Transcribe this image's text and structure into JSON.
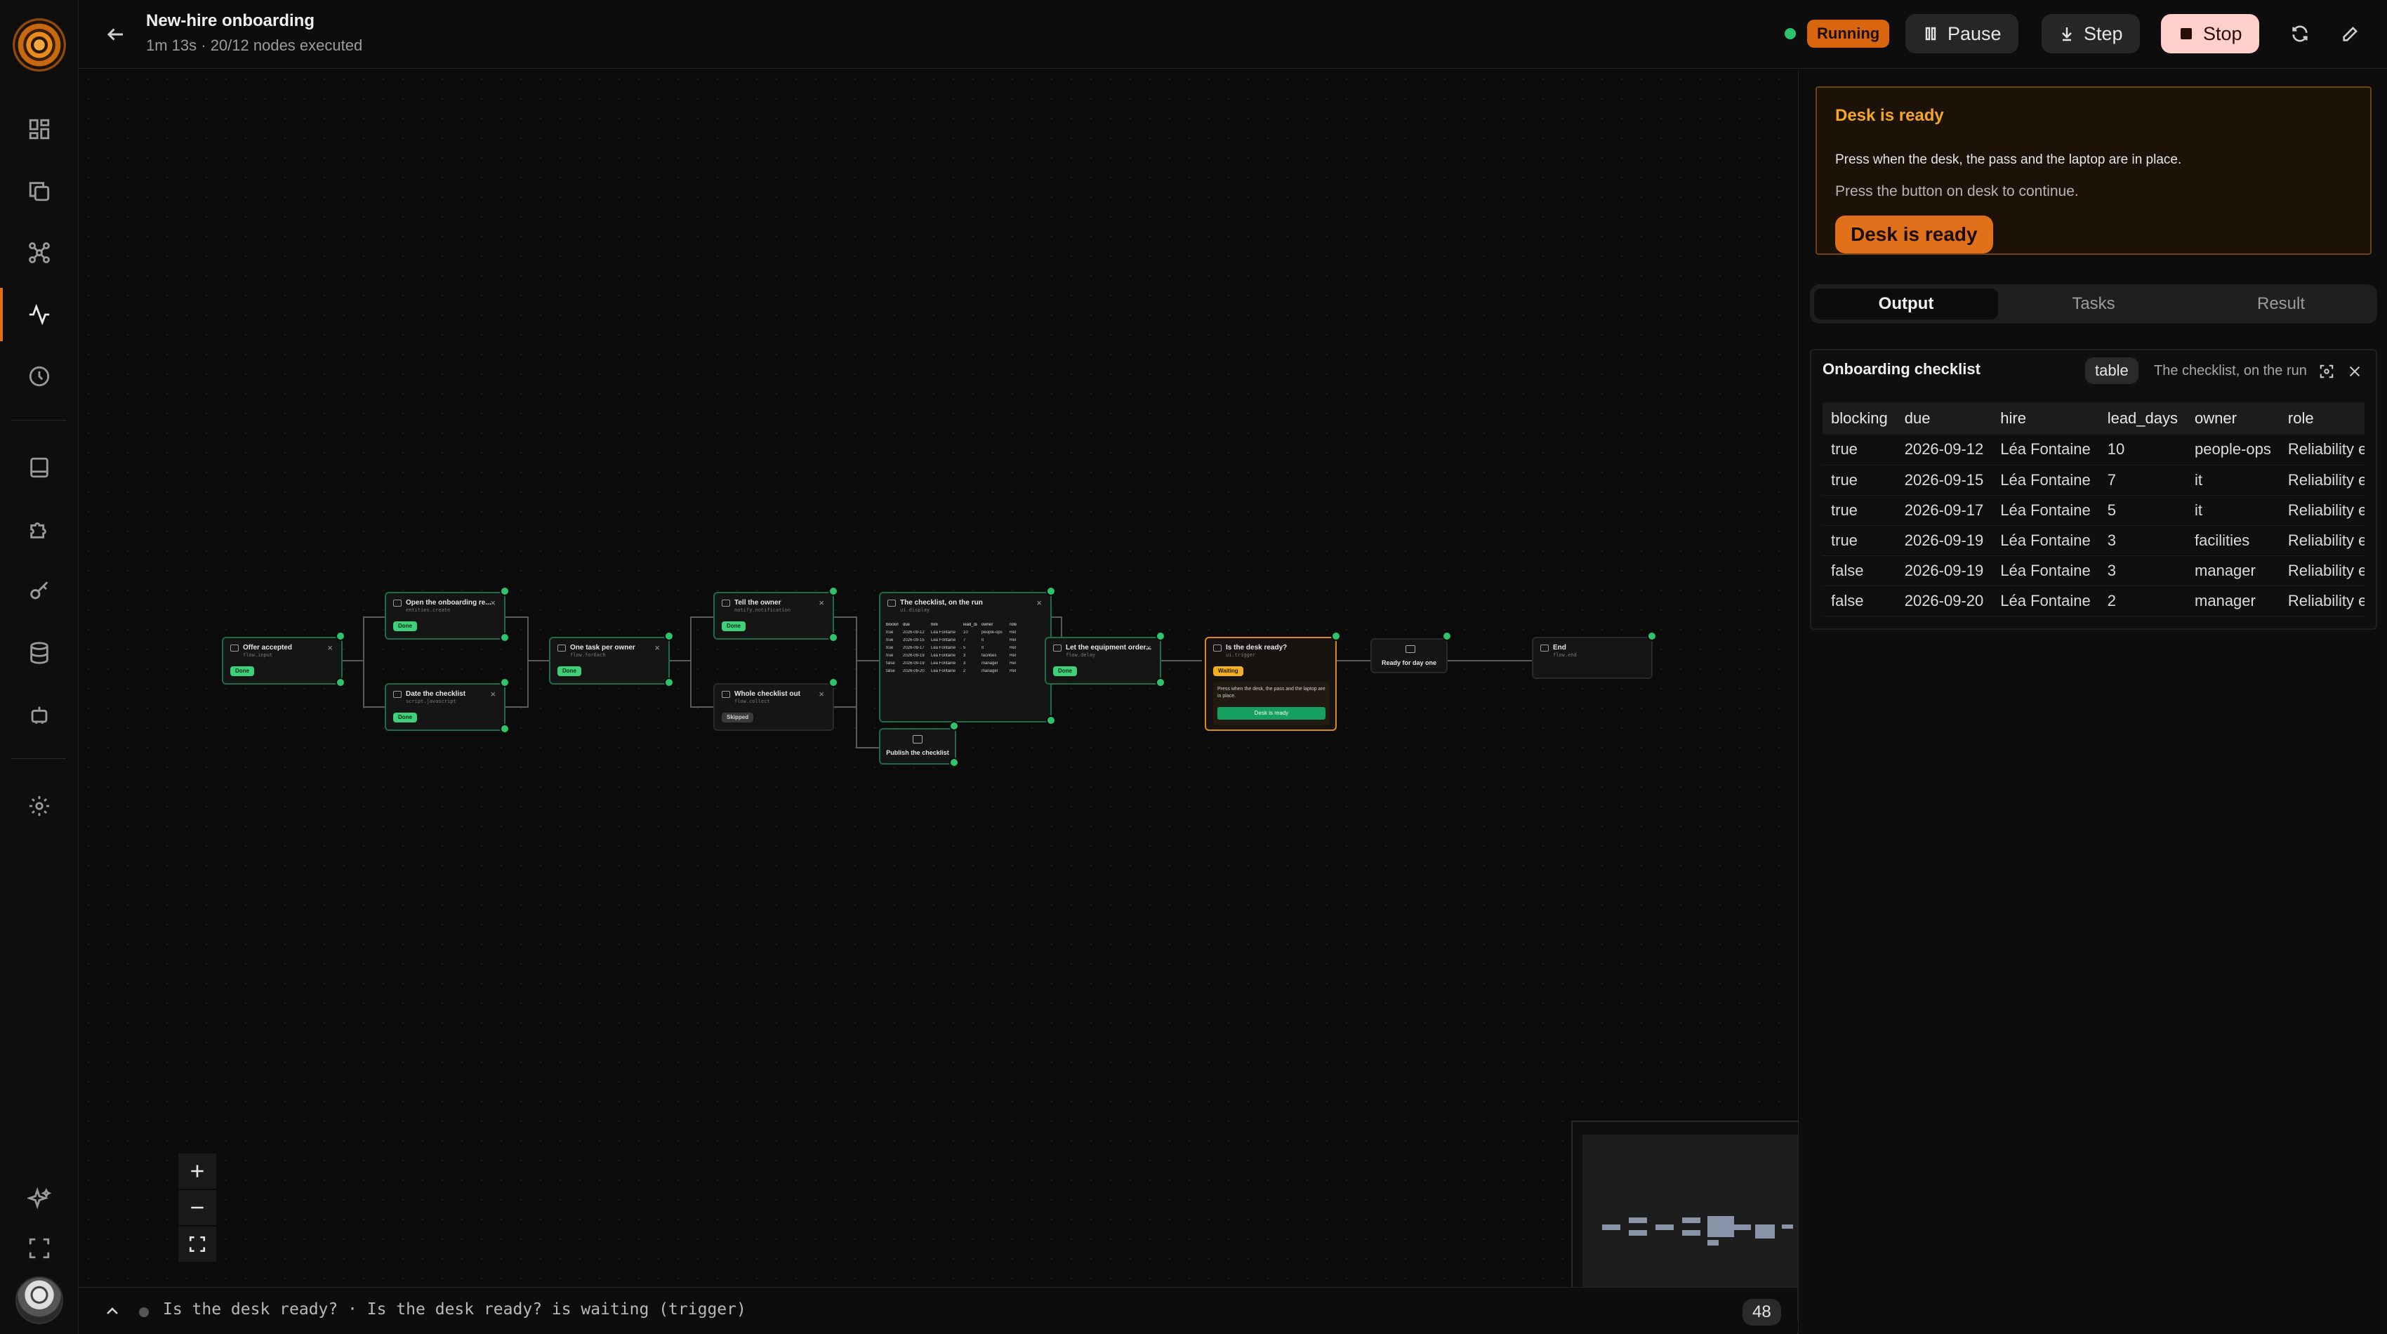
{
  "header": {
    "title": "New-hire onboarding",
    "subtitle": "1m 13s · 20/12 nodes executed",
    "status": "Running",
    "pause_label": "Pause",
    "step_label": "Step",
    "stop_label": "Stop"
  },
  "nodes": [
    {
      "title": "Offer accepted",
      "sub": "flow.input",
      "status": "Done"
    },
    {
      "title": "Open the onboarding re...",
      "sub": "entities.create",
      "status": "Done"
    },
    {
      "title": "Date the checklist",
      "sub": "script.javascript",
      "status": "Done"
    },
    {
      "title": "One task per owner",
      "sub": "flow.forEach",
      "status": "Done"
    },
    {
      "title": "Tell the owner",
      "sub": "notify.notification",
      "status": "Done"
    },
    {
      "title": "Whole checklist out",
      "sub": "flow.collect",
      "status": "Skipped"
    },
    {
      "title": "The checklist, on the run",
      "sub": "ui.display"
    },
    {
      "title": "Publish the checklist"
    },
    {
      "title": "Let the equipment order...",
      "sub": "flow.delay",
      "status": "Done"
    },
    {
      "title": "Is the desk ready?",
      "sub": "ui.trigger",
      "status": "Waiting",
      "prompt": "Press when the desk, the pass and the laptop are in place.",
      "button": "Desk is ready"
    },
    {
      "title": "Ready for day one"
    },
    {
      "title": "End",
      "sub": "flow.end"
    }
  ],
  "canvas_checklist": {
    "headers": [
      "blocking",
      "due",
      "hire",
      "lead_days",
      "owner",
      "role"
    ],
    "rows": [
      [
        "true",
        "2026-09-12",
        "Léa Fontaine",
        "10",
        "people-ops",
        "Rel"
      ],
      [
        "true",
        "2026-09-15",
        "Léa Fontaine",
        "7",
        "it",
        "Rel"
      ],
      [
        "true",
        "2026-09-17",
        "Léa Fontaine",
        "5",
        "it",
        "Rel"
      ],
      [
        "true",
        "2026-09-19",
        "Léa Fontaine",
        "3",
        "facilities",
        "Rel"
      ],
      [
        "false",
        "2026-09-19",
        "Léa Fontaine",
        "3",
        "manager",
        "Rel"
      ],
      [
        "false",
        "2026-09-20",
        "Léa Fontaine",
        "2",
        "manager",
        "Rel"
      ]
    ]
  },
  "bottom": {
    "message": "Is the desk ready? · Is the desk ready? is waiting (trigger)",
    "count": "48"
  },
  "panel": {
    "prompt": {
      "heading": "Desk is ready",
      "text": "Press when the desk, the pass and the laptop are in place.",
      "hint": "Press the button on desk to continue.",
      "button": "Desk is ready"
    },
    "tabs": [
      "Output",
      "Tasks",
      "Result"
    ],
    "active_tab": "Output",
    "output": {
      "title": "Onboarding checklist",
      "type": "table",
      "description": "The checklist, on the run",
      "columns": [
        "blocking",
        "due",
        "hire",
        "lead_days",
        "owner",
        "role"
      ],
      "rows": [
        [
          "true",
          "2026-09-12",
          "Léa Fontaine",
          "10",
          "people-ops",
          "Reliability e"
        ],
        [
          "true",
          "2026-09-15",
          "Léa Fontaine",
          "7",
          "it",
          "Reliability e"
        ],
        [
          "true",
          "2026-09-17",
          "Léa Fontaine",
          "5",
          "it",
          "Reliability e"
        ],
        [
          "true",
          "2026-09-19",
          "Léa Fontaine",
          "3",
          "facilities",
          "Reliability e"
        ],
        [
          "false",
          "2026-09-19",
          "Léa Fontaine",
          "3",
          "manager",
          "Reliability e"
        ],
        [
          "false",
          "2026-09-20",
          "Léa Fontaine",
          "2",
          "manager",
          "Reliability e"
        ]
      ]
    }
  },
  "colors": {
    "accent": "#e0701a",
    "done": "#3fd07a",
    "node_border": "#1d6b47",
    "waiting": "#f0b020"
  }
}
